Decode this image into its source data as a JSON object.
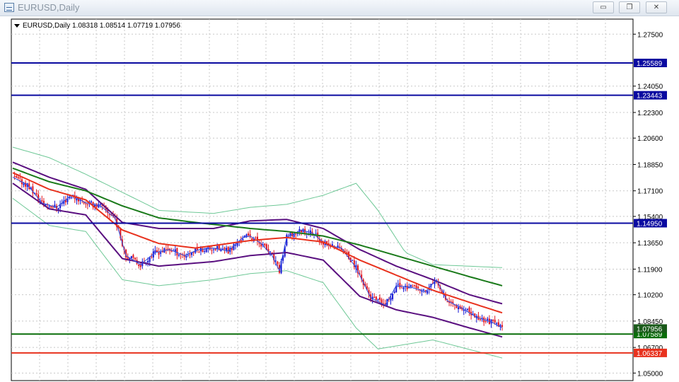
{
  "window": {
    "title": "EURUSD,Daily",
    "minimize_label": "▭",
    "restore_label": "❐",
    "close_label": "✕"
  },
  "header": {
    "symbol_line": "EURUSD,Daily  1.08318 1.08514 1.07719 1.07956"
  },
  "colors": {
    "grid": "#c8c8c8",
    "bull": "#1414d2",
    "bear": "#e0141e",
    "blue_line": "#0a0aa0",
    "green_line": "#0a6e0a",
    "red_line": "#e8321e",
    "ma_red": "#e8321e",
    "ma_green": "#1a7a1a",
    "bb_purple": "#5a1080",
    "bb_outer": "#6ec896",
    "ma_blue": "#3050e0"
  },
  "chart_data": {
    "type": "candlestick",
    "symbol": "EURUSD",
    "timeframe": "Daily",
    "ylim": [
      1.045,
      1.285
    ],
    "y_ticks": [
      1.275,
      1.2405,
      1.223,
      1.206,
      1.1885,
      1.171,
      1.154,
      1.1365,
      1.119,
      1.102,
      1.0845,
      1.067,
      1.05
    ],
    "y_tick_labels": [
      "1.27500",
      "1.24050",
      "1.22300",
      "1.20600",
      "1.18850",
      "1.17100",
      "1.15400",
      "1.13650",
      "1.11900",
      "1.10200",
      "1.08450",
      "1.06700",
      "1.05000"
    ],
    "ohlc_last": {
      "open": 1.08318,
      "high": 1.08514,
      "low": 1.07719,
      "close": 1.07956
    },
    "horizontal_lines": [
      {
        "price": 1.25589,
        "label": "1.25589",
        "color": "blue"
      },
      {
        "price": 1.23443,
        "label": "1.23443",
        "color": "blue"
      },
      {
        "price": 1.1495,
        "label": "1.14950",
        "color": "blue"
      },
      {
        "price": 1.07589,
        "label": "1.07589",
        "color": "green"
      },
      {
        "price": 1.06337,
        "label": "1.06337",
        "color": "red"
      }
    ],
    "current_price_label": "1.07956",
    "close_path": [
      [
        0,
        1.18
      ],
      [
        8,
        1.175
      ],
      [
        16,
        1.163
      ],
      [
        24,
        1.16
      ],
      [
        32,
        1.168
      ],
      [
        40,
        1.163
      ],
      [
        48,
        1.161
      ],
      [
        56,
        1.153
      ],
      [
        62,
        1.128
      ],
      [
        70,
        1.122
      ],
      [
        78,
        1.13
      ],
      [
        86,
        1.132
      ],
      [
        94,
        1.128
      ],
      [
        102,
        1.132
      ],
      [
        110,
        1.133
      ],
      [
        118,
        1.131
      ],
      [
        126,
        1.14
      ],
      [
        130,
        1.141
      ],
      [
        136,
        1.136
      ],
      [
        142,
        1.128
      ],
      [
        146,
        1.118
      ],
      [
        150,
        1.14
      ],
      [
        158,
        1.145
      ],
      [
        164,
        1.143
      ],
      [
        172,
        1.135
      ],
      [
        180,
        1.133
      ],
      [
        188,
        1.12
      ],
      [
        196,
        1.1
      ],
      [
        204,
        1.095
      ],
      [
        210,
        1.108
      ],
      [
        218,
        1.107
      ],
      [
        226,
        1.104
      ],
      [
        232,
        1.112
      ],
      [
        238,
        1.098
      ],
      [
        246,
        1.093
      ],
      [
        254,
        1.087
      ],
      [
        262,
        1.084
      ],
      [
        268,
        1.08
      ]
    ],
    "moving_averages": {
      "red": [
        [
          0,
          1.183
        ],
        [
          20,
          1.172
        ],
        [
          40,
          1.165
        ],
        [
          60,
          1.145
        ],
        [
          80,
          1.136
        ],
        [
          100,
          1.133
        ],
        [
          130,
          1.138
        ],
        [
          150,
          1.14
        ],
        [
          170,
          1.137
        ],
        [
          190,
          1.125
        ],
        [
          210,
          1.115
        ],
        [
          230,
          1.105
        ],
        [
          250,
          1.097
        ],
        [
          268,
          1.09
        ]
      ],
      "green": [
        [
          0,
          1.186
        ],
        [
          20,
          1.177
        ],
        [
          40,
          1.171
        ],
        [
          60,
          1.161
        ],
        [
          80,
          1.153
        ],
        [
          100,
          1.15
        ],
        [
          130,
          1.146
        ],
        [
          150,
          1.144
        ],
        [
          170,
          1.141
        ],
        [
          190,
          1.135
        ],
        [
          210,
          1.128
        ],
        [
          230,
          1.121
        ],
        [
          250,
          1.114
        ],
        [
          268,
          1.108
        ]
      ]
    },
    "bollinger": {
      "upper": [
        [
          0,
          1.19
        ],
        [
          20,
          1.18
        ],
        [
          40,
          1.172
        ],
        [
          60,
          1.15
        ],
        [
          80,
          1.146
        ],
        [
          110,
          1.146
        ],
        [
          130,
          1.151
        ],
        [
          150,
          1.152
        ],
        [
          170,
          1.146
        ],
        [
          190,
          1.132
        ],
        [
          210,
          1.121
        ],
        [
          230,
          1.112
        ],
        [
          250,
          1.102
        ],
        [
          268,
          1.096
        ]
      ],
      "lower": [
        [
          0,
          1.176
        ],
        [
          20,
          1.159
        ],
        [
          40,
          1.155
        ],
        [
          60,
          1.126
        ],
        [
          80,
          1.121
        ],
        [
          110,
          1.124
        ],
        [
          130,
          1.128
        ],
        [
          150,
          1.13
        ],
        [
          170,
          1.125
        ],
        [
          190,
          1.101
        ],
        [
          210,
          1.092
        ],
        [
          230,
          1.087
        ],
        [
          250,
          1.08
        ],
        [
          268,
          1.074
        ]
      ],
      "outer_upper": [
        [
          0,
          1.2
        ],
        [
          20,
          1.193
        ],
        [
          40,
          1.182
        ],
        [
          60,
          1.17
        ],
        [
          80,
          1.158
        ],
        [
          110,
          1.156
        ],
        [
          130,
          1.16
        ],
        [
          150,
          1.162
        ],
        [
          170,
          1.168
        ],
        [
          188,
          1.176
        ],
        [
          200,
          1.158
        ],
        [
          215,
          1.13
        ],
        [
          230,
          1.122
        ],
        [
          268,
          1.12
        ]
      ],
      "outer_lower": [
        [
          0,
          1.166
        ],
        [
          20,
          1.148
        ],
        [
          40,
          1.144
        ],
        [
          60,
          1.112
        ],
        [
          80,
          1.108
        ],
        [
          110,
          1.112
        ],
        [
          130,
          1.116
        ],
        [
          150,
          1.118
        ],
        [
          170,
          1.11
        ],
        [
          188,
          1.08
        ],
        [
          200,
          1.066
        ],
        [
          230,
          1.072
        ],
        [
          268,
          1.06
        ]
      ]
    }
  }
}
